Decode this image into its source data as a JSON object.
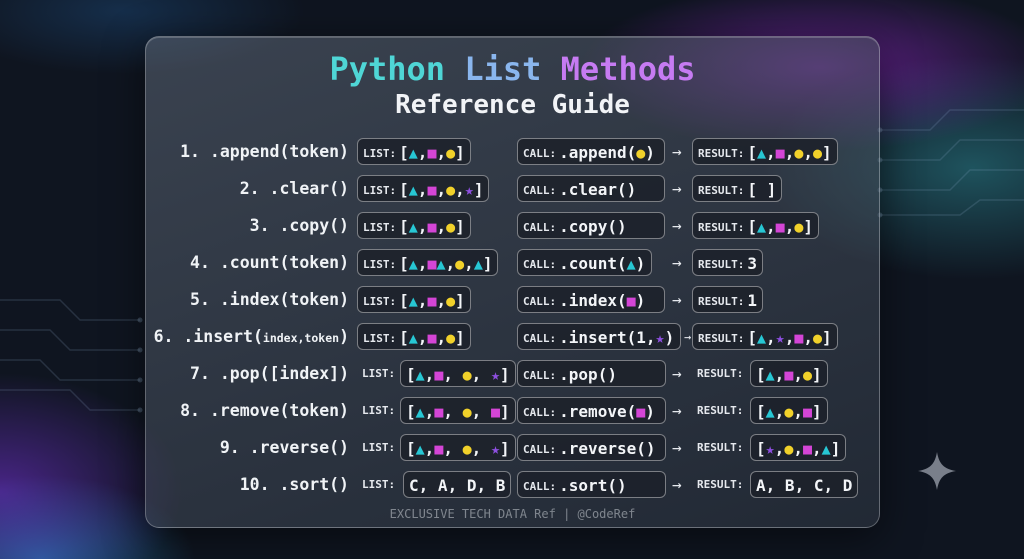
{
  "header": {
    "title_word1": "Python",
    "title_word2": "List",
    "title_word3": "Methods",
    "subtitle": "Reference Guide"
  },
  "labels": {
    "list": "LIST:",
    "call": "CALL:",
    "result": "RESULT:"
  },
  "rows": [
    {
      "num": "1.",
      "method": ".append(token)",
      "list": "[▲,■,●]",
      "call": ".append(●)",
      "result": "[▲,■,●,●]"
    },
    {
      "num": "2.",
      "method": ".clear()",
      "list": "[▲,■,●,★]",
      "call": ".clear()",
      "result": "[ ]"
    },
    {
      "num": "3.",
      "method": ".copy()",
      "list": "[▲,■,●]",
      "call": ".copy()",
      "result": "[▲,■,●]"
    },
    {
      "num": "4.",
      "method": ".count(token)",
      "list": "[▲,■▲,●,▲]",
      "call": ".count(▲)",
      "result": "3"
    },
    {
      "num": "5.",
      "method": ".index(token)",
      "list": "[▲,■,●]",
      "call": ".index(■)",
      "result": "1"
    },
    {
      "num": "6.",
      "method_main": ".insert(",
      "method_args": "index,token",
      "method_close": ")",
      "list": "[▲,■,●]",
      "call": ".insert(1,★)",
      "result": "[▲,★,■,●]"
    },
    {
      "num": "7.",
      "method": ".pop([index])",
      "list": "[▲,■, ●, ★]",
      "call": ".pop()",
      "result": "[▲,■,●]"
    },
    {
      "num": "8.",
      "method": ".remove(token)",
      "list": "[▲,■, ●, ■]",
      "call": ".remove(■)",
      "result": "[▲,●,■]"
    },
    {
      "num": "9.",
      "method": ".reverse()",
      "list": "[▲,■, ●, ★]",
      "call": ".reverse()",
      "result": "[★,●,■,▲]"
    },
    {
      "num": "10.",
      "method": ".sort()",
      "list": "C, A, D, B",
      "call": ".sort()",
      "result": "A, B, C, D"
    }
  ],
  "footer": "EXCLUSIVE TECH DATA Ref | @CodeRef",
  "colors": {
    "triangle": "#27c7d4",
    "square": "#d445d6",
    "circle": "#f1d12a",
    "star": "#8e4fe0",
    "title_python": "#4fd6d6",
    "title_list": "#8ab6ee",
    "title_methods": "#c67bf2"
  },
  "icons": [
    "triangle-token-icon",
    "square-token-icon",
    "circle-token-icon",
    "star-token-icon",
    "arrow-right-icon",
    "sparkle-icon"
  ]
}
